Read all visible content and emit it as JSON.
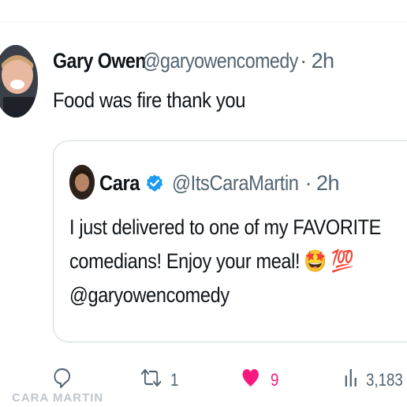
{
  "tweet": {
    "author_name": "Gary Owen",
    "author_handle": "@garyowencomedy",
    "separator": "·",
    "time": "2h",
    "text": "Food was fire thank you"
  },
  "quote": {
    "author_name": "Cara",
    "author_handle": "@ItsCaraMartin",
    "separator": "·",
    "time": "2h",
    "line1": "I just delivered to one of my FAVORITE",
    "line2": "comedians! Enjoy your meal!",
    "line3": "@garyowencomedy",
    "emoji_star_eyes": "🤩",
    "emoji_hundred": "💯"
  },
  "actions": {
    "reposts": "1",
    "likes": "9",
    "views": "3,183"
  },
  "watermark": {
    "text": "CARA MARTIN"
  },
  "colors": {
    "like_pink": "#f91880",
    "verified_blue": "#1d9bf0",
    "muted": "#536471"
  },
  "icons": [
    "reply-icon",
    "repost-icon",
    "heart-icon",
    "views-icon",
    "verified-badge-icon"
  ]
}
